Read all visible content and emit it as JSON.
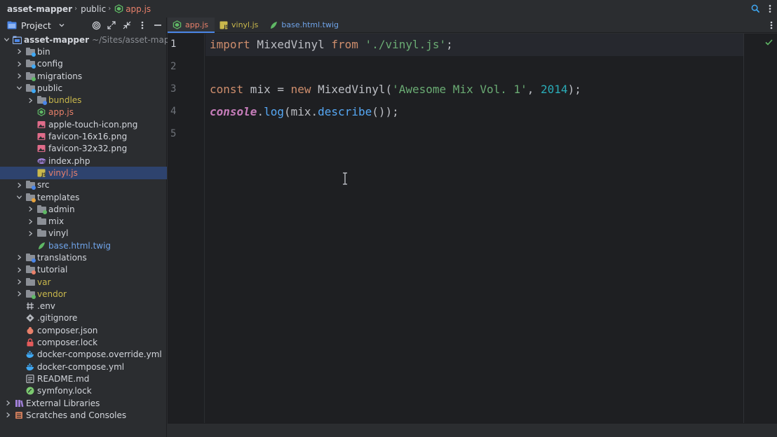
{
  "breadcrumb": {
    "items": [
      "asset-mapper",
      "public",
      "app.js"
    ]
  },
  "project_panel": {
    "title": "Project",
    "tree": [
      {
        "label": "asset-mapper",
        "path": "~/Sites/asset-mapper",
        "depth": 0,
        "state": "expanded",
        "icon": "module-folder-icon",
        "style": "bold"
      },
      {
        "label": "bin",
        "depth": 1,
        "state": "collapsed",
        "icon": "folder-icon",
        "badge": "#3fa9f5"
      },
      {
        "label": "config",
        "depth": 1,
        "state": "collapsed",
        "icon": "folder-icon",
        "badge": "#3fa9f5"
      },
      {
        "label": "migrations",
        "depth": 1,
        "state": "collapsed",
        "icon": "folder-icon",
        "badge": "#5fb865"
      },
      {
        "label": "public",
        "depth": 1,
        "state": "expanded",
        "icon": "folder-icon",
        "badge": "#3fa9f5"
      },
      {
        "label": "bundles",
        "depth": 2,
        "state": "collapsed",
        "icon": "folder-icon",
        "badge": "#4a86e8",
        "style": "yellow"
      },
      {
        "label": "app.js",
        "depth": 2,
        "state": "leaf",
        "icon": "nodejs-file-icon",
        "style": "red"
      },
      {
        "label": "apple-touch-icon.png",
        "depth": 2,
        "state": "leaf",
        "icon": "image-file-icon"
      },
      {
        "label": "favicon-16x16.png",
        "depth": 2,
        "state": "leaf",
        "icon": "image-file-icon"
      },
      {
        "label": "favicon-32x32.png",
        "depth": 2,
        "state": "leaf",
        "icon": "image-file-icon"
      },
      {
        "label": "index.php",
        "depth": 2,
        "state": "leaf",
        "icon": "php-file-icon"
      },
      {
        "label": "vinyl.js",
        "depth": 2,
        "state": "leaf",
        "icon": "js-file-icon",
        "style": "red",
        "selected": true
      },
      {
        "label": "src",
        "depth": 1,
        "state": "collapsed",
        "icon": "folder-icon",
        "badge": "#4a86e8"
      },
      {
        "label": "templates",
        "depth": 1,
        "state": "expanded",
        "icon": "folder-icon",
        "badge": "#e8a33d"
      },
      {
        "label": "admin",
        "depth": 2,
        "state": "collapsed",
        "icon": "folder-icon",
        "badge": "#5fb865"
      },
      {
        "label": "mix",
        "depth": 2,
        "state": "collapsed",
        "icon": "folder-icon"
      },
      {
        "label": "vinyl",
        "depth": 2,
        "state": "collapsed",
        "icon": "folder-icon"
      },
      {
        "label": "base.html.twig",
        "depth": 2,
        "state": "leaf",
        "icon": "twig-file-icon",
        "style": "blue"
      },
      {
        "label": "translations",
        "depth": 1,
        "state": "collapsed",
        "icon": "folder-icon",
        "badge": "#4a86e8"
      },
      {
        "label": "tutorial",
        "depth": 1,
        "state": "collapsed",
        "icon": "folder-icon",
        "badge": "#e8806a"
      },
      {
        "label": "var",
        "depth": 1,
        "state": "collapsed",
        "icon": "folder-icon",
        "style": "yellow"
      },
      {
        "label": "vendor",
        "depth": 1,
        "state": "collapsed",
        "icon": "folder-icon",
        "badge": "#5fb865",
        "style": "yellow"
      },
      {
        "label": ".env",
        "depth": 1,
        "state": "leaf",
        "icon": "env-file-icon"
      },
      {
        "label": ".gitignore",
        "depth": 1,
        "state": "leaf",
        "icon": "git-file-icon"
      },
      {
        "label": "composer.json",
        "depth": 1,
        "state": "leaf",
        "icon": "composer-file-icon"
      },
      {
        "label": "composer.lock",
        "depth": 1,
        "state": "leaf",
        "icon": "lock-file-icon"
      },
      {
        "label": "docker-compose.override.yml",
        "depth": 1,
        "state": "leaf",
        "icon": "docker-file-icon"
      },
      {
        "label": "docker-compose.yml",
        "depth": 1,
        "state": "leaf",
        "icon": "docker-file-icon"
      },
      {
        "label": "README.md",
        "depth": 1,
        "state": "leaf",
        "icon": "markdown-file-icon"
      },
      {
        "label": "symfony.lock",
        "depth": 1,
        "state": "leaf",
        "icon": "symfony-file-icon"
      },
      {
        "label": "External Libraries",
        "depth": 0,
        "state": "collapsed",
        "icon": "library-icon"
      },
      {
        "label": "Scratches and Consoles",
        "depth": 0,
        "state": "collapsed",
        "icon": "scratches-icon"
      }
    ]
  },
  "editor": {
    "tabs": [
      {
        "label": "app.js",
        "icon": "nodejs-file-icon",
        "style": "red",
        "active": true
      },
      {
        "label": "vinyl.js",
        "icon": "js-file-icon",
        "style": "yellow"
      },
      {
        "label": "base.html.twig",
        "icon": "twig-file-icon",
        "style": "blue"
      }
    ],
    "line_numbers": [
      "1",
      "2",
      "3",
      "4",
      "5"
    ],
    "code": {
      "l1_kw1": "import",
      "l1_name": " MixedVinyl ",
      "l1_kw2": "from",
      "l1_str": " './vinyl.js'",
      "l1_end": ";",
      "l3_kw1": "const",
      "l3_mid": " mix = ",
      "l3_kw2": "new",
      "l3_call": " MixedVinyl(",
      "l3_str": "'Awesome Mix Vol. 1'",
      "l3_sep": ", ",
      "l3_num": "2014",
      "l3_end": ");",
      "l4_glob": "console",
      "l4_dot": ".",
      "l4_fn1": "log",
      "l4_mid": "(mix.",
      "l4_fn2": "describe",
      "l4_end": "());"
    }
  },
  "colors": {
    "accent": "#4a86e8",
    "keyword": "#cf8e6d",
    "string": "#6aab73",
    "number": "#2aacb8",
    "function": "#56a8f5",
    "global": "#c77dbb",
    "modified_file": "#e8806a"
  }
}
